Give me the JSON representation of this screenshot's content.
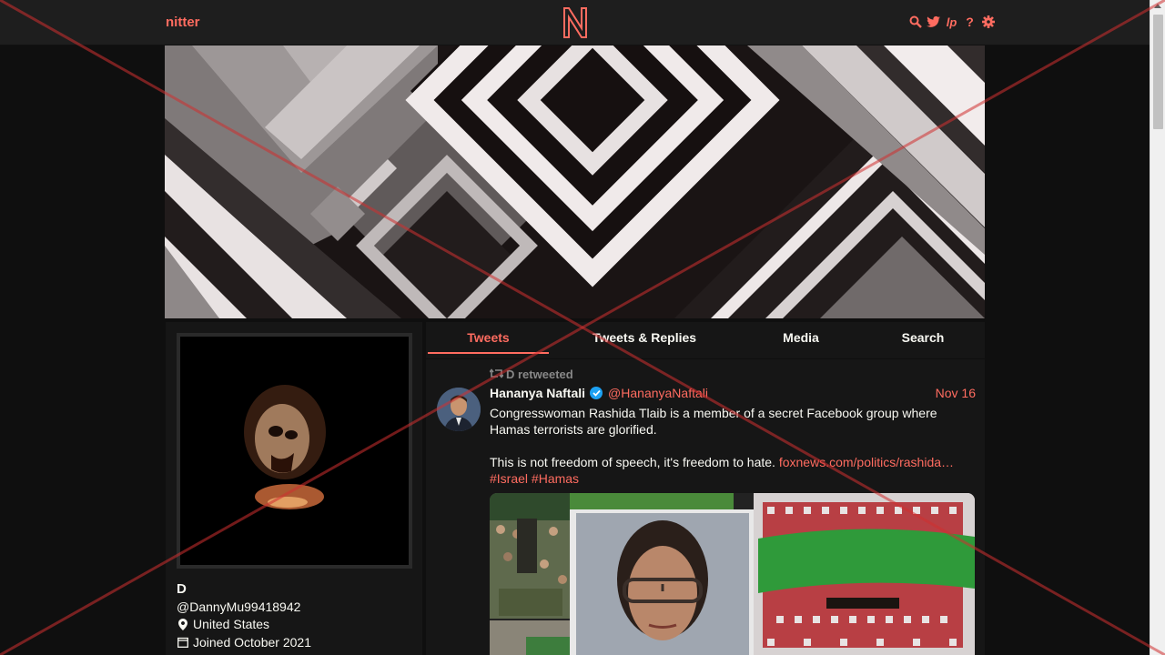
{
  "nav": {
    "brand": "nitter",
    "icons": [
      "search-icon",
      "twitter-bird-icon",
      "liberapay-icon",
      "help-icon",
      "gear-icon"
    ],
    "accent": "#ff6c60"
  },
  "profile": {
    "name": "D",
    "handle": "@DannyMu99418942",
    "location": "United States",
    "joined": "Joined October 2021"
  },
  "tabs": [
    {
      "label": "Tweets",
      "active": true
    },
    {
      "label": "Tweets & Replies",
      "active": false
    },
    {
      "label": "Media",
      "active": false
    },
    {
      "label": "Search",
      "active": false
    }
  ],
  "tweet": {
    "retweet_label": "D retweeted",
    "fullname": "Hananya Naftali",
    "username": "@HananyaNaftali",
    "date": "Nov 16",
    "text_1": "Congresswoman Rashida Tlaib is a member of a secret Facebook group where Hamas terrorists are glorified.",
    "text_2": "This is not freedom of speech, it's freedom to hate.",
    "link": "foxnews.com/politics/rashida…",
    "hashtag_1": "#Israel",
    "hashtag_2": "#Hamas"
  }
}
